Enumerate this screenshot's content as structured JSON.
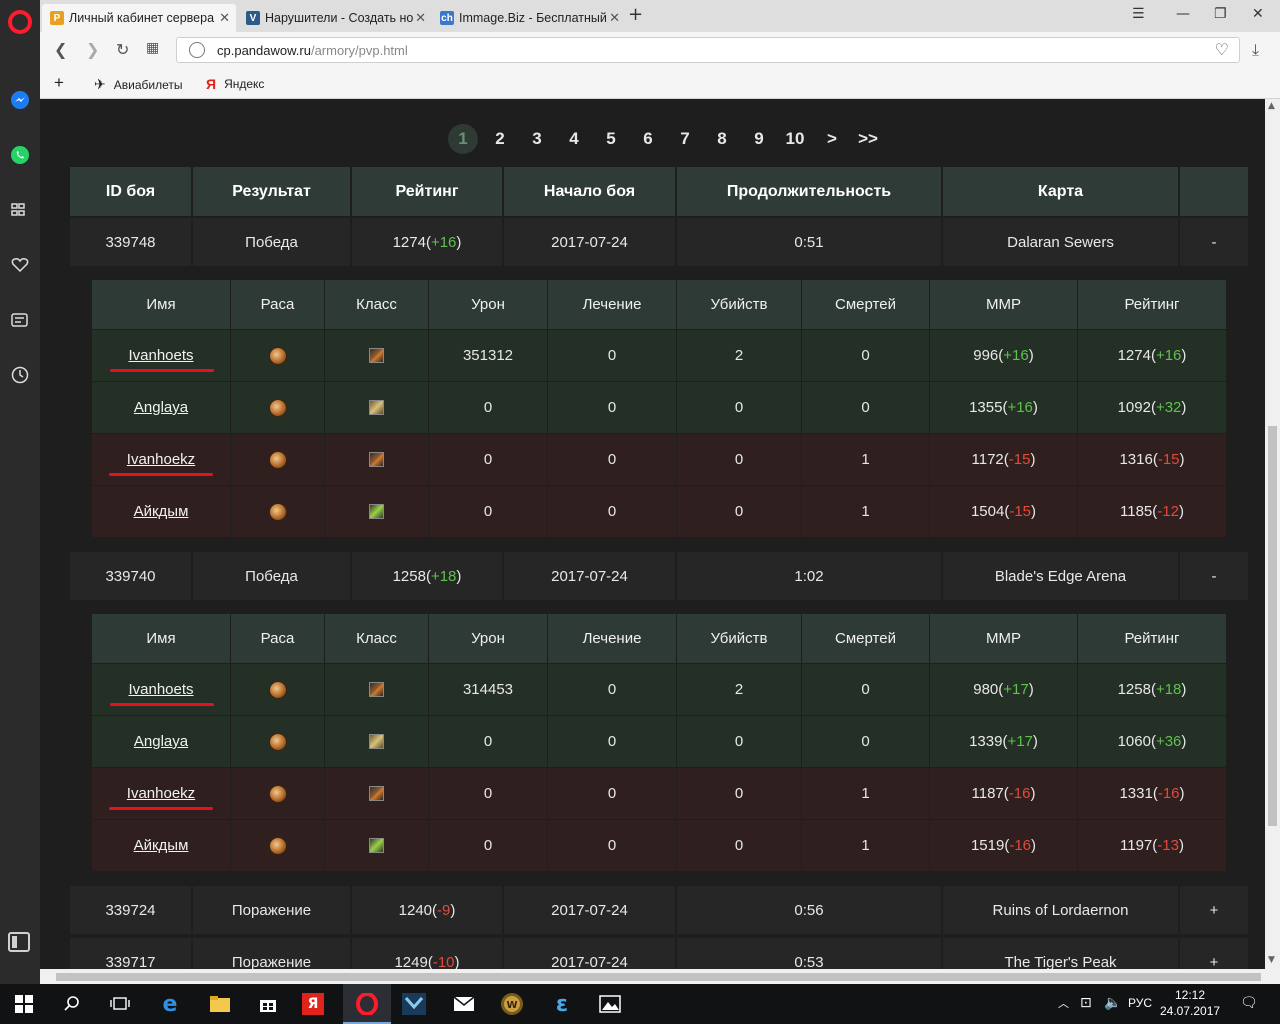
{
  "browser": {
    "tabs": [
      {
        "title": "Личный кабинет сервера",
        "favicon": "P",
        "favicon_color": "#e8a020"
      },
      {
        "title": "Нарушители - Создать но",
        "favicon": "V",
        "favicon_color": "#2d5a86"
      },
      {
        "title": "Immage.Biz - Бесплатный",
        "favicon": "ch",
        "favicon_color": "#3a78c8"
      }
    ],
    "new_tab": "+",
    "url_domain": "cp.pandawow.ru",
    "url_path": "/armory/pvp.html",
    "bookmarks": [
      {
        "label": "Авиабилеты",
        "icon": "plane-icon"
      },
      {
        "label": "Яндекс",
        "icon": "yandex-icon"
      }
    ],
    "bookmark_add": "+"
  },
  "pagination": {
    "pages": [
      "1",
      "2",
      "3",
      "4",
      "5",
      "6",
      "7",
      "8",
      "9",
      "10",
      ">",
      ">>"
    ],
    "active": "1"
  },
  "table_headers": [
    "ID боя",
    "Результат",
    "Рейтинг",
    "Начало боя",
    "Продолжительность",
    "Карта",
    ""
  ],
  "sub_headers": [
    "Имя",
    "Раса",
    "Класс",
    "Урон",
    "Лечение",
    "Убийств",
    "Смертей",
    "MMP",
    "Рейтинг"
  ],
  "battles": [
    {
      "id": "339748",
      "result": "Победа",
      "rating": "1274",
      "rating_delta": "+16",
      "start": "2017-07-24",
      "duration": "0:51",
      "map": "Dalaran Sewers",
      "toggle": "-",
      "players": [
        {
          "name": "Ivanhoets",
          "class": "warrior",
          "damage": "351312",
          "heal": "0",
          "kills": "2",
          "deaths": "0",
          "mmr": "996",
          "mmr_delta": "+16",
          "rating": "1274",
          "rating_delta": "+16",
          "team": "win",
          "marked": true
        },
        {
          "name": "Anglaya",
          "class": "paladin",
          "damage": "0",
          "heal": "0",
          "kills": "0",
          "deaths": "0",
          "mmr": "1355",
          "mmr_delta": "+16",
          "rating": "1092",
          "rating_delta": "+32",
          "team": "win",
          "marked": false
        },
        {
          "name": "Ivanhoekz",
          "class": "warrior",
          "damage": "0",
          "heal": "0",
          "kills": "0",
          "deaths": "1",
          "mmr": "1172",
          "mmr_delta": "-15",
          "rating": "1316",
          "rating_delta": "-15",
          "team": "lose",
          "marked": true
        },
        {
          "name": "Айкдым",
          "class": "hunter",
          "damage": "0",
          "heal": "0",
          "kills": "0",
          "deaths": "1",
          "mmr": "1504",
          "mmr_delta": "-15",
          "rating": "1185",
          "rating_delta": "-12",
          "team": "lose",
          "marked": false
        }
      ]
    },
    {
      "id": "339740",
      "result": "Победа",
      "rating": "1258",
      "rating_delta": "+18",
      "start": "2017-07-24",
      "duration": "1:02",
      "map": "Blade's Edge Arena",
      "toggle": "-",
      "players": [
        {
          "name": "Ivanhoets",
          "class": "warrior",
          "damage": "314453",
          "heal": "0",
          "kills": "2",
          "deaths": "0",
          "mmr": "980",
          "mmr_delta": "+17",
          "rating": "1258",
          "rating_delta": "+18",
          "team": "win",
          "marked": true
        },
        {
          "name": "Anglaya",
          "class": "paladin",
          "damage": "0",
          "heal": "0",
          "kills": "0",
          "deaths": "0",
          "mmr": "1339",
          "mmr_delta": "+17",
          "rating": "1060",
          "rating_delta": "+36",
          "team": "win",
          "marked": false
        },
        {
          "name": "Ivanhoekz",
          "class": "warrior",
          "damage": "0",
          "heal": "0",
          "kills": "0",
          "deaths": "1",
          "mmr": "1187",
          "mmr_delta": "-16",
          "rating": "1331",
          "rating_delta": "-16",
          "team": "lose",
          "marked": true
        },
        {
          "name": "Айкдым",
          "class": "hunter",
          "damage": "0",
          "heal": "0",
          "kills": "0",
          "deaths": "1",
          "mmr": "1519",
          "mmr_delta": "-16",
          "rating": "1197",
          "rating_delta": "-13",
          "team": "lose",
          "marked": false
        }
      ]
    },
    {
      "id": "339724",
      "result": "Поражение",
      "rating": "1240",
      "rating_delta": "-9",
      "start": "2017-07-24",
      "duration": "0:56",
      "map": "Ruins of Lordaernon",
      "toggle": "+",
      "players": []
    },
    {
      "id": "339717",
      "result": "Поражение",
      "rating": "1249",
      "rating_delta": "-10",
      "start": "2017-07-24",
      "duration": "0:53",
      "map": "The Tiger's Peak",
      "toggle": "+",
      "players": []
    }
  ],
  "taskbar": {
    "lang": "РУС",
    "time": "12:12",
    "date": "24.07.2017"
  },
  "colors": {
    "positive": "#5fc14e",
    "negative": "#e34a3a",
    "win_row": "#243026",
    "lose_row": "#2f1f1f",
    "header": "#2f3b36"
  }
}
